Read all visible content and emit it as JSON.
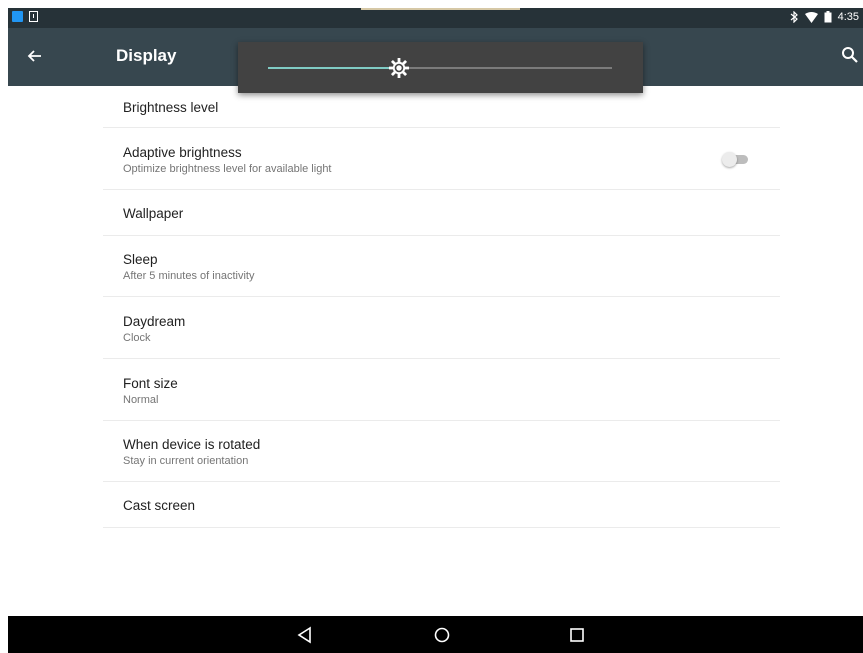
{
  "status_bar": {
    "time": "4:35",
    "left_icons": [
      "app-notification-icon",
      "download-icon"
    ],
    "right_icons": [
      "bluetooth-icon",
      "wifi-icon",
      "battery-icon"
    ]
  },
  "app_bar": {
    "title": "Display",
    "back_icon": "arrow-left-icon",
    "search_icon": "search-icon"
  },
  "brightness_dialog": {
    "value": 0.38,
    "accent_color": "#80cbc4",
    "icon": "brightness-icon"
  },
  "settings": [
    {
      "label": "Brightness level",
      "summary": ""
    },
    {
      "label": "Adaptive brightness",
      "summary": "Optimize brightness level for available light",
      "toggle": false
    },
    {
      "label": "Wallpaper",
      "summary": ""
    },
    {
      "label": "Sleep",
      "summary": "After 5 minutes of inactivity"
    },
    {
      "label": "Daydream",
      "summary": "Clock"
    },
    {
      "label": "Font size",
      "summary": "Normal"
    },
    {
      "label": "When device is rotated",
      "summary": "Stay in current orientation"
    },
    {
      "label": "Cast screen",
      "summary": ""
    }
  ],
  "nav_bar": {
    "buttons": [
      "back-triangle-icon",
      "home-circle-icon",
      "recents-square-icon"
    ]
  }
}
